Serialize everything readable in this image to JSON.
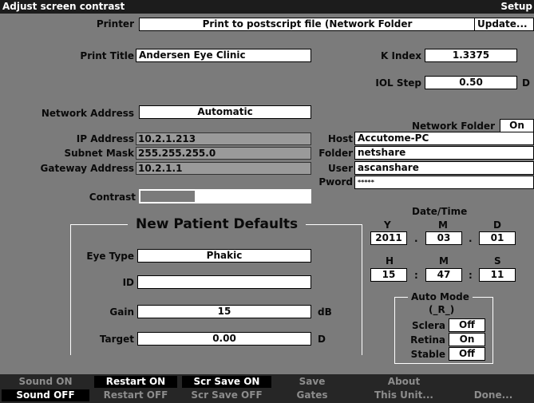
{
  "window": {
    "title": "Adjust screen contrast",
    "mode": "Setup"
  },
  "printer": {
    "label": "Printer",
    "value": "Print to postscript file (Network Folder",
    "update_label": "Update..."
  },
  "print_title": {
    "label": "Print Title",
    "value": "Andersen Eye Clinic"
  },
  "k_index": {
    "label": "K Index",
    "value": "1.3375"
  },
  "iol_step": {
    "label": "IOL Step",
    "value": "0.50",
    "unit": "D"
  },
  "network_address": {
    "label": "Network Address",
    "value": "Automatic"
  },
  "ip": {
    "ip_label": "IP Address",
    "ip_value": "10.2.1.213",
    "subnet_label": "Subnet Mask",
    "subnet_value": "255.255.255.0",
    "gateway_label": "Gateway Address",
    "gateway_value": "10.2.1.1"
  },
  "network_folder": {
    "label": "Network Folder",
    "toggle": "On",
    "host_label": "Host",
    "host_value": "Accutome-PC",
    "folder_label": "Folder",
    "folder_value": "netshare",
    "user_label": "User",
    "user_value": "ascanshare",
    "pword_label": "Pword",
    "pword_value": "*****"
  },
  "contrast": {
    "label": "Contrast",
    "level": 0.32
  },
  "patient_defaults": {
    "title": "New Patient Defaults",
    "eye_type_label": "Eye Type",
    "eye_type_value": "Phakic",
    "id_label": "ID",
    "id_value": "",
    "gain_label": "Gain",
    "gain_value": "15",
    "gain_unit": "dB",
    "target_label": "Target",
    "target_value": "0.00",
    "target_unit": "D"
  },
  "datetime": {
    "title": "Date/Time",
    "y_label": "Y",
    "m_label": "M",
    "d_label": "D",
    "year": "2011",
    "month": "03",
    "day": "01",
    "date_sep": ".",
    "h_label": "H",
    "min_label": "M",
    "s_label": "S",
    "hour": "15",
    "minute": "47",
    "second": "11",
    "time_sep": ":"
  },
  "auto_mode": {
    "title": "Auto Mode",
    "mode": "(_R_)",
    "sclera_label": "Sclera",
    "sclera_value": "Off",
    "retina_label": "Retina",
    "retina_value": "On",
    "stable_label": "Stable",
    "stable_value": "Off"
  },
  "softkeys": {
    "sound_on": "Sound ON",
    "sound_off": "Sound OFF",
    "restart_on": "Restart ON",
    "restart_off": "Restart OFF",
    "scr_save_on": "Scr Save ON",
    "scr_save_off": "Scr Save OFF",
    "save": "Save",
    "gates": "Gates",
    "about": "About",
    "this_unit": "This Unit...",
    "done": "Done..."
  }
}
